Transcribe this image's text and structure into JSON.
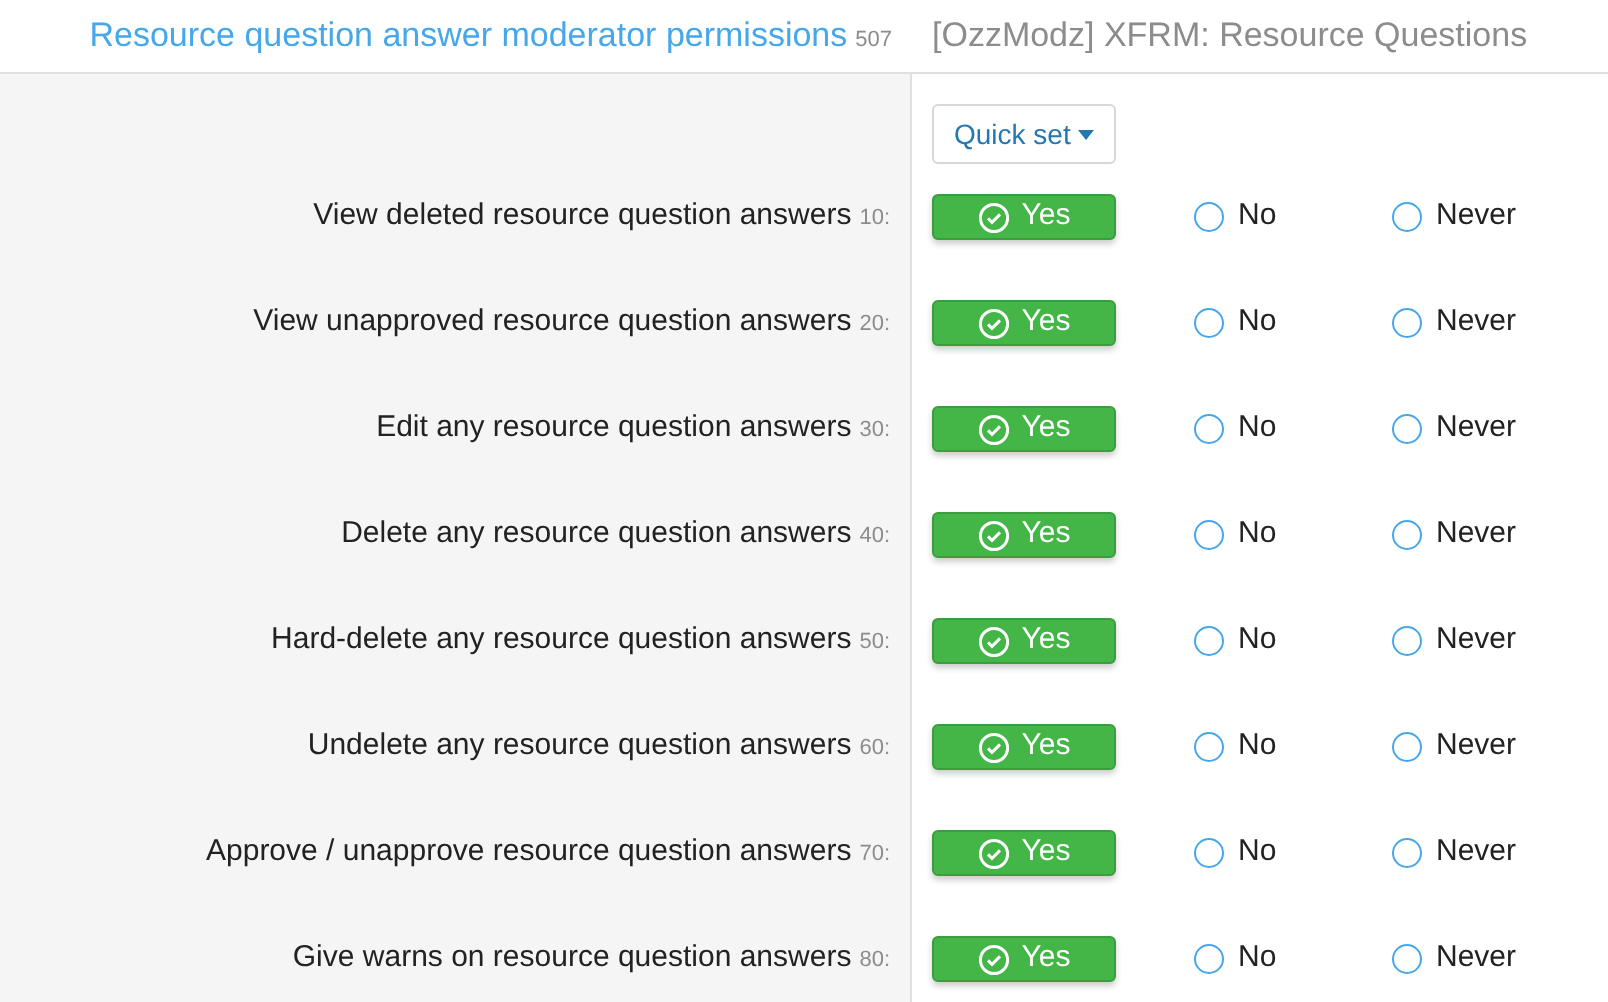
{
  "header": {
    "title": "Resource question answer moderator permissions",
    "count": "507",
    "addon": "[OzzModz] XFRM: Resource Questions"
  },
  "quick_set": {
    "label": "Quick set"
  },
  "permissions": [
    {
      "label": "View deleted resource question answers",
      "order": "10:",
      "options": [
        {
          "label": "Yes",
          "selected": true
        },
        {
          "label": "No",
          "selected": false
        },
        {
          "label": "Never",
          "selected": false
        }
      ]
    },
    {
      "label": "View unapproved resource question answers",
      "order": "20:",
      "options": [
        {
          "label": "Yes",
          "selected": true
        },
        {
          "label": "No",
          "selected": false
        },
        {
          "label": "Never",
          "selected": false
        }
      ]
    },
    {
      "label": "Edit any resource question answers",
      "order": "30:",
      "options": [
        {
          "label": "Yes",
          "selected": true
        },
        {
          "label": "No",
          "selected": false
        },
        {
          "label": "Never",
          "selected": false
        }
      ]
    },
    {
      "label": "Delete any resource question answers",
      "order": "40:",
      "options": [
        {
          "label": "Yes",
          "selected": true
        },
        {
          "label": "No",
          "selected": false
        },
        {
          "label": "Never",
          "selected": false
        }
      ]
    },
    {
      "label": "Hard-delete any resource question answers",
      "order": "50:",
      "options": [
        {
          "label": "Yes",
          "selected": true
        },
        {
          "label": "No",
          "selected": false
        },
        {
          "label": "Never",
          "selected": false
        }
      ]
    },
    {
      "label": "Undelete any resource question answers",
      "order": "60:",
      "options": [
        {
          "label": "Yes",
          "selected": true
        },
        {
          "label": "No",
          "selected": false
        },
        {
          "label": "Never",
          "selected": false
        }
      ]
    },
    {
      "label": "Approve / unapprove resource question answers",
      "order": "70:",
      "options": [
        {
          "label": "Yes",
          "selected": true
        },
        {
          "label": "No",
          "selected": false
        },
        {
          "label": "Never",
          "selected": false
        }
      ]
    },
    {
      "label": "Give warns on resource question answers",
      "order": "80:",
      "options": [
        {
          "label": "Yes",
          "selected": true
        },
        {
          "label": "No",
          "selected": false
        },
        {
          "label": "Never",
          "selected": false
        }
      ]
    }
  ]
}
